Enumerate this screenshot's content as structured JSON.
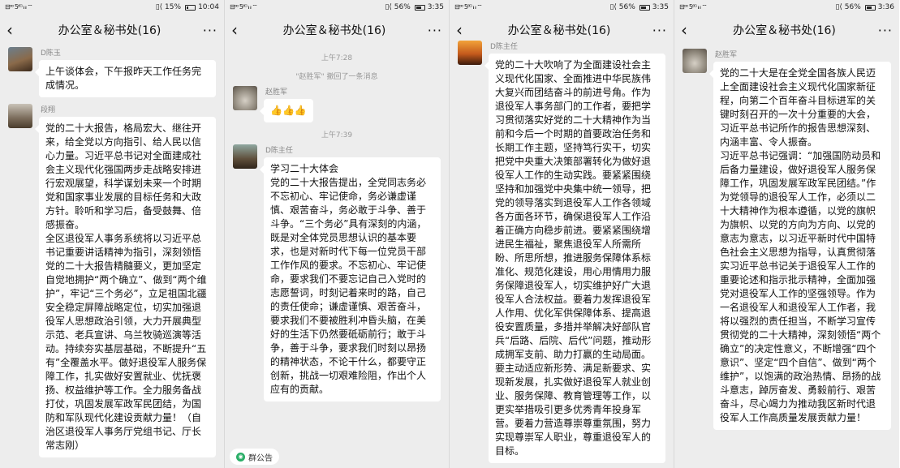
{
  "screens": [
    {
      "status": {
        "left": "⊟ᵒᵒ 5⁶ᴳ ᵢₗ ᵢₗ ⌔",
        "right": "▯⟨ 15%",
        "time": "10:04",
        "battery": 0.15
      },
      "header": {
        "back": "‹",
        "title": "办公室＆秘书处(16)",
        "more": "···"
      },
      "messages": [
        {
          "sender": "D陈玉",
          "text": "上午谈体会，下午报昨天工作任务完成情况。"
        },
        {
          "sender": "段翔",
          "text": "党的二十大报告，格局宏大、继往开来，给全党以方向指引、给人民以信心力量。习近平总书记对全面建成社会主义现代化强国两步走战略安排进行宏观展望，科学谋划未来一个时期党和国家事业发展的目标任务和大政方针。聆听和学习后，备受鼓舞、倍感振奋。\n全区退役军人事务系统将以习近平总书记重要讲话精神为指引，深刻领悟党的二十大报告精髓要义，更加坚定自觉地拥护“两个确立”、做到“两个维护”，牢记“三个务必”，立足祖国北疆安全稳定屏障战略定位，切实加强退役军人思想政治引领，大力开展典型示范、老兵宣讲、乌兰牧骑巡演等活动。持续夯实基层基础，不断提升“五有”全覆盖水平。做好退役军人服务保障工作，扎实做好安置就业、优抚褒扬、权益维护等工作。全力服务备战打仗，巩固发展军政军民团结，为国防和军队现代化建设贡献力量！（自治区退役军人事务厅党组书记、厅长常志刚）"
        }
      ]
    },
    {
      "status": {
        "left": "⊟ᵒᵒ 5⁶ᴳ ᵢₗ ᵢₗ ⌔",
        "right": "▯⟨ 56%",
        "time": "3:35",
        "battery": 0.56
      },
      "header": {
        "back": "‹",
        "title": "办公室＆秘书处(16)",
        "more": "···"
      },
      "time1": "上午7:28",
      "recall": "\"赵胜军\" 撤回了一条消息",
      "msg1": {
        "sender": "赵胜军",
        "text": "👍👍👍"
      },
      "time2": "上午7:39",
      "msg2": {
        "sender": "D陈主任",
        "text": "学习二十大体会\n党的二十大报告提出，全党同志务必不忘初心、牢记使命，务必谦虚谨慎、艰苦奋斗，务必敢于斗争、善于斗争。“三个务必”具有深刻的内涵，既是对全体党员思想认识的基本要求，也是对新时代下每一位党员干部工作作风的要求。不忘初心、牢记使命，要求我们不要忘记自己入党时的志愿誓词，时刻记着来时的路，自己的责任使命；谦虚谨慎、艰苦奋斗，要求我们不要被胜利冲昏头脑，在美好的生活下仍然要砥砺前行；敢于斗争，善于斗争，要求我们时刻以昂扬的精神状态，不论干什么，都要守正创新，挑战一切艰难险阻，作出个人应有的贡献。"
      },
      "notice": "群公告"
    },
    {
      "status": {
        "left": "⊟ᵒᵒ 5⁶ᴳ ᵢₗ ᵢₗ ⌔",
        "right": "▯⟨ 56%",
        "time": "3:35",
        "battery": 0.56
      },
      "header": {
        "back": "‹",
        "title": "办公室＆秘书处(16)",
        "more": "···"
      },
      "messages": [
        {
          "sender": "D陈主任",
          "text": "党的二十大吹响了为全面建设社会主义现代化国家、全面推进中华民族伟大复兴而团结奋斗的前进号角。作为退役军人事务部门的工作者，要把学习贯彻落实好党的二十大精神作为当前和今后一个时期的首要政治任务和长期工作主题，坚持笃行实干，切实把党中央重大决策部署转化为做好退役军人工作的生动实践。要紧紧围绕坚持和加强党中央集中统一领导，把党的领导落实到退役军人工作各领域各方面各环节，确保退役军人工作沿着正确方向稳步前进。要紧紧围绕增进民生福祉，聚焦退役军人所需所盼、所思所想，推进服务保障体系标准化、规范化建设，用心用情用力服务保障退役军人，切实维护好广大退役军人合法权益。要着力发挥退役军人作用、优化军供保障体系、提高退役安置质量，多措并举解决好部队官兵“后路、后院、后代”问题，推动形成拥军支前、助力打赢的生动局面。要主动适应新形势、满足新要求、实现新发展，扎实做好退役军人就业创业、服务保障、教育管理等工作，以更实举措吸引更多优秀青年投身军营。要着力营造尊崇尊重氛围，努力实现尊崇军人职业，尊重退役军人的目标。"
        }
      ]
    },
    {
      "status": {
        "left": "⊟ᵒᵒ 5⁶ᴳ ᵢₗ ᵢₗ ⌔",
        "right": "▯⟨ 56%",
        "time": "3:36",
        "battery": 0.56
      },
      "header": {
        "back": "‹",
        "title": "办公室＆秘书处(16)",
        "more": "···"
      },
      "messages": [
        {
          "sender": "赵胜军",
          "text": "党的二十大是在全党全国各族人民迈上全面建设社会主义现代化国家新征程，向第二个百年奋斗目标进军的关键时刻召开的一次十分重要的大会，习近平总书记所作的报告思想深刻、内涵丰富、令人振奋。\n习近平总书记强调：“加强国防动员和后备力量建设，做好退役军人服务保障工作，巩固发展军政军民团结。”作为党领导的退役军人工作，必须以二十大精神作为根本遵循，以党的旗帜为旗帜、以党的方向为方向、以党的意志为意志，以习近平新时代中国特色社会主义思想为指导，认真贯彻落实习近平总书记关于退役军人工作的重要论述和指示批示精神，全面加强党对退役军人工作的坚强领导。作为一名退役军人和退役军人工作者，我将以强烈的责任担当，不断学习宣传贯彻党的二十大精神，深刻领悟“两个确立”的决定性意义，不断增强“四个意识”、坚定“四个自信”、做到“两个维护”，以饱满的政治热情、昂扬的战斗意志，踔厉奋发、勇毅前行、艰苦奋斗，尽心竭力为推动我区新时代退役军人工作高质量发展贡献力量！"
        }
      ]
    }
  ]
}
